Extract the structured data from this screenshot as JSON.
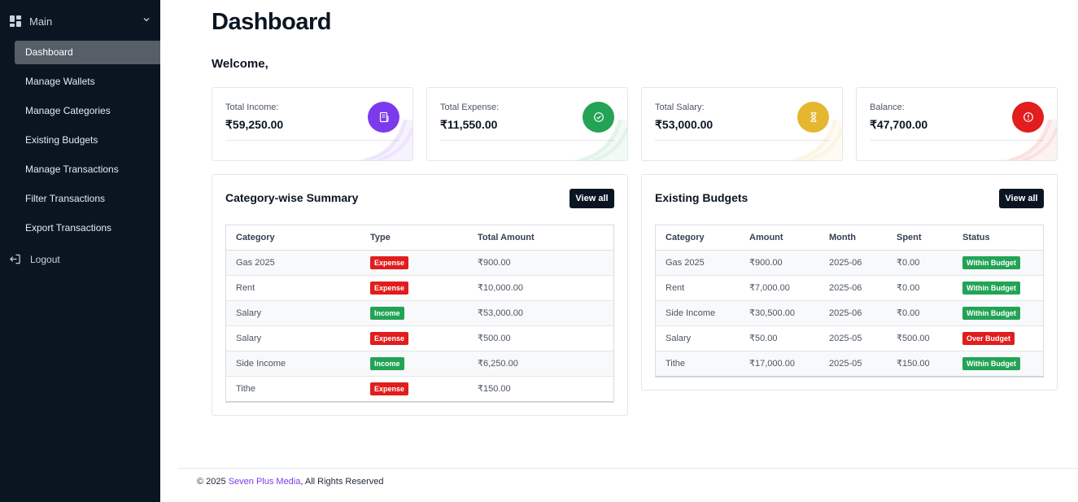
{
  "sidebar": {
    "menu_title": "Main",
    "items": [
      {
        "label": "Dashboard",
        "active": true
      },
      {
        "label": "Manage Wallets",
        "active": false
      },
      {
        "label": "Manage Categories",
        "active": false
      },
      {
        "label": "Existing Budgets",
        "active": false
      },
      {
        "label": "Manage Transactions",
        "active": false
      },
      {
        "label": "Filter Transactions",
        "active": false
      },
      {
        "label": "Export Transactions",
        "active": false
      }
    ],
    "logout": "Logout"
  },
  "header": {
    "title": "Dashboard",
    "welcome": "Welcome,"
  },
  "stats": [
    {
      "label": "Total Income:",
      "value": "₹59,250.00",
      "icon": "receipt-icon",
      "color": "#7c3aed"
    },
    {
      "label": "Total Expense:",
      "value": "₹11,550.00",
      "icon": "check-circle-icon",
      "color": "#22a356"
    },
    {
      "label": "Total Salary:",
      "value": "₹53,000.00",
      "icon": "hourglass-icon",
      "color": "#e5b730"
    },
    {
      "label": "Balance:",
      "value": "₹47,700.00",
      "icon": "alert-circle-icon",
      "color": "#e11d1d"
    }
  ],
  "summary": {
    "title": "Category-wise Summary",
    "view_all": "View all",
    "columns": [
      "Category",
      "Type",
      "Total Amount"
    ],
    "rows": [
      {
        "category": "Gas 2025",
        "type": "Expense",
        "amount": "₹900.00"
      },
      {
        "category": "Rent",
        "type": "Expense",
        "amount": "₹10,000.00"
      },
      {
        "category": "Salary",
        "type": "Income",
        "amount": "₹53,000.00"
      },
      {
        "category": "Salary",
        "type": "Expense",
        "amount": "₹500.00"
      },
      {
        "category": "Side Income",
        "type": "Income",
        "amount": "₹6,250.00"
      },
      {
        "category": "Tithe",
        "type": "Expense",
        "amount": "₹150.00"
      }
    ]
  },
  "budgets": {
    "title": "Existing Budgets",
    "view_all": "View all",
    "columns": [
      "Category",
      "Amount",
      "Month",
      "Spent",
      "Status"
    ],
    "rows": [
      {
        "category": "Gas 2025",
        "amount": "₹900.00",
        "month": "2025-06",
        "spent": "₹0.00",
        "status": "Within Budget"
      },
      {
        "category": "Rent",
        "amount": "₹7,000.00",
        "month": "2025-06",
        "spent": "₹0.00",
        "status": "Within Budget"
      },
      {
        "category": "Side Income",
        "amount": "₹30,500.00",
        "month": "2025-06",
        "spent": "₹0.00",
        "status": "Within Budget"
      },
      {
        "category": "Salary",
        "amount": "₹50.00",
        "month": "2025-05",
        "spent": "₹500.00",
        "status": "Over Budget"
      },
      {
        "category": "Tithe",
        "amount": "₹17,000.00",
        "month": "2025-05",
        "spent": "₹150.00",
        "status": "Within Budget"
      }
    ]
  },
  "footer": {
    "prefix": "© 2025 ",
    "company": "Seven Plus Media",
    "suffix": ", All Rights Reserved"
  },
  "colors": {
    "sidebar_bg": "#0b1522",
    "expense_badge": "#e11d1d",
    "income_badge": "#22a356",
    "link": "#7c3aed"
  }
}
